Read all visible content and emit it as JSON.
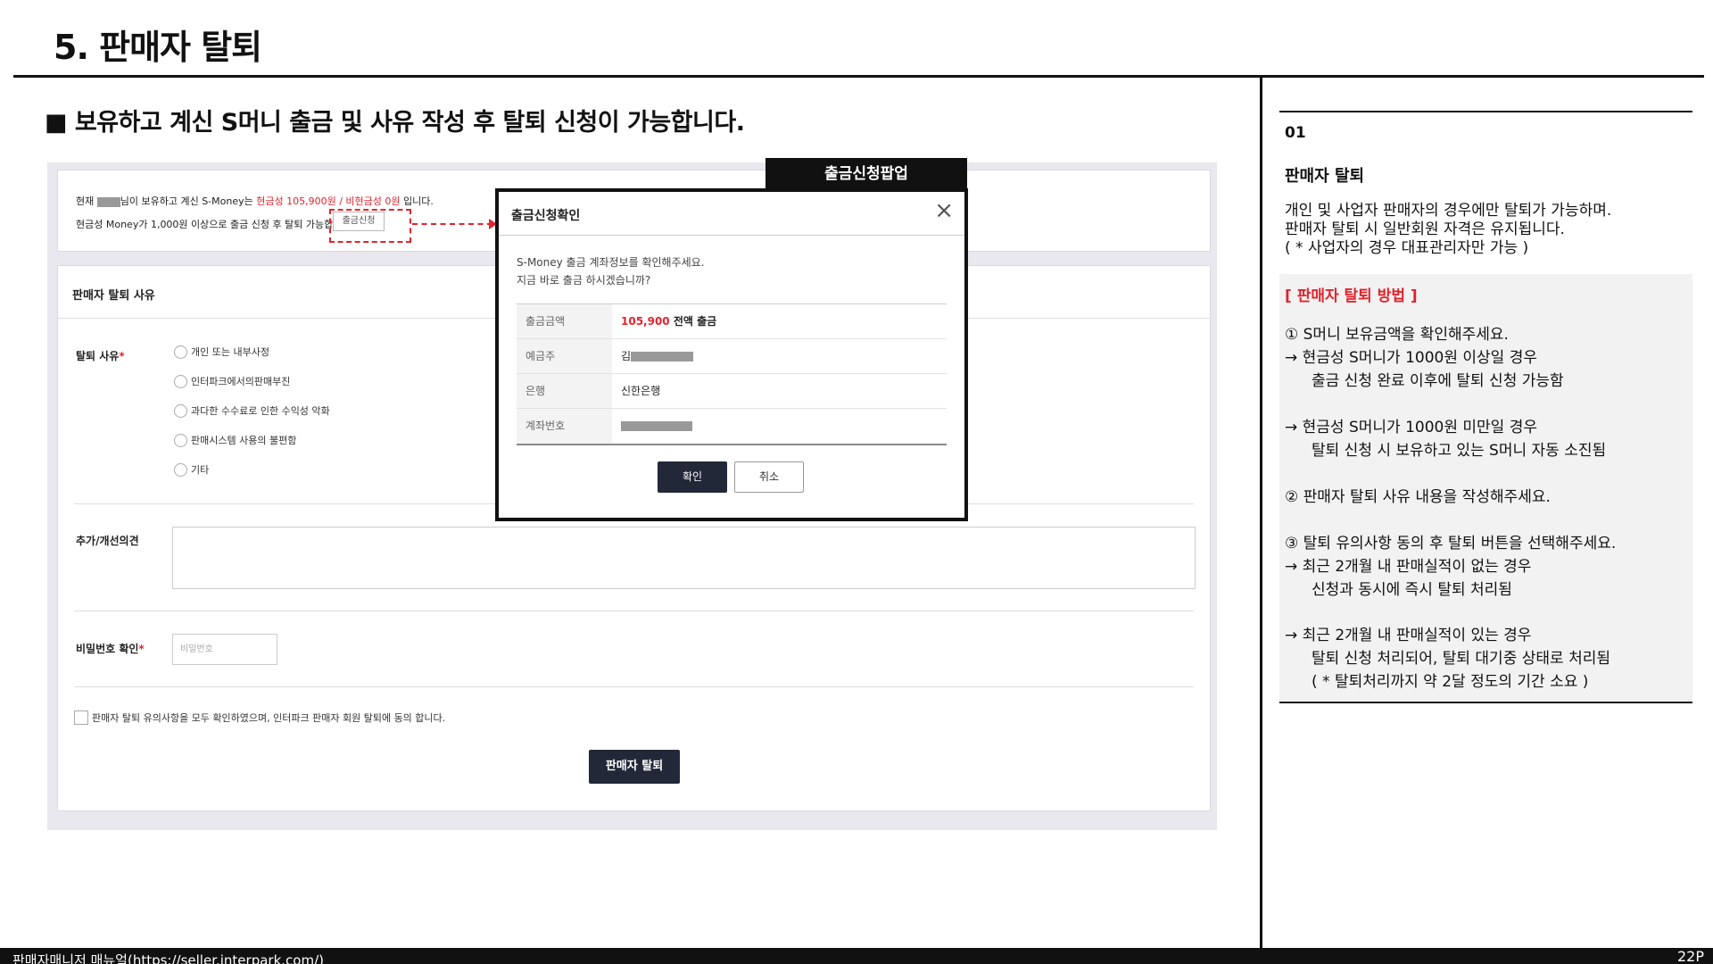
{
  "page": {
    "title": "5. 판매자 탈퇴",
    "subheading": "■ 보유하고 계신 S머니 출금 및 사유 작성 후 탈퇴 신청이 가능합니다."
  },
  "smoney_box": {
    "line1_prefix": "현재 ",
    "line1_masked_suffix": "님이 보유하고 계신 S-Money는 ",
    "line1_cash": "현금성 105,900원 / 비현금성 0원",
    "line1_end": " 입니다.",
    "line2": "현금성 Money가 1,000원 이상으로 출금 신청 후 탈퇴 가능합니다.",
    "withdraw_request_btn": "출금신청"
  },
  "form": {
    "header": "판매자 탈퇴 사유",
    "reason_label": "탈퇴 사유",
    "reasons": [
      "개인 또는 내부사정",
      "인터파크에서의판매부진",
      "과다한 수수료로 인한 수익성 악화",
      "판매시스템 사용의 불편함",
      "기타"
    ],
    "feedback_label": "추가/개선의견",
    "password_label": "비밀번호 확인",
    "password_placeholder": "비밀번호",
    "agree_text": "판매자 탈퇴 유의사항을 모두 확인하였으며, 인터파크 판매자 회원 탈퇴에 동의 합니다.",
    "submit": "판매자 탈퇴"
  },
  "popup": {
    "tag": "출금신청팝업",
    "title": "출금신청확인",
    "msg1": "S-Money 출금 계좌정보를 확인해주세요.",
    "msg2": "지금 바로 출금 하시겠습니까?",
    "rows": [
      {
        "label": "출금금액",
        "amount": "105,900",
        "suffix": " 전액 출금"
      },
      {
        "label": "예금주",
        "value": "김"
      },
      {
        "label": "은행",
        "value": "신한은행"
      },
      {
        "label": "계좌번호",
        "value": ""
      }
    ],
    "ok": "확인",
    "cancel": "취소"
  },
  "right_panel": {
    "number": "01",
    "title": "판매자 탈퇴",
    "desc": [
      "개인 및 사업자 판매자의 경우에만 탈퇴가 가능하며.",
      "판매자 탈퇴 시 일반회원 자격은 유지됩니다.",
      "( * 사업자의 경우 대표관리자만 가능 )"
    ],
    "method_title": "[ 판매자 탈퇴 방법 ]",
    "step1": "① S머니 보유금액을 확인해주세요.",
    "step1_a": " → 현금성 S머니가 1000원 이상일 경우",
    "step1_a2": "출금 신청 완료 이후에 탈퇴 신청 가능함",
    "step1_b": " → 현금성 S머니가 1000원 미만일 경우",
    "step1_b2": "탈퇴 신청 시 보유하고 있는 S머니 자동 소진됨",
    "step2": "② 판매자 탈퇴 사유 내용을 작성해주세요.",
    "step3": "③ 탈퇴 유의사항 동의 후 탈퇴 버튼을 선택해주세요.",
    "step3_a": " → 최근 2개월 내 판매실적이 없는 경우",
    "step3_a2": "신청과 동시에 즉시 탈퇴 처리됨",
    "step3_b": " → 최근 2개월 내 판매실적이 있는 경우",
    "step3_b2": "탈퇴 신청 처리되어, 탈퇴 대기중 상태로 처리됨",
    "step3_b3": "( * 탈퇴처리까지 약 2달 정도의 기간 소요  )"
  },
  "footer": {
    "left": "판매자매니저 매뉴얼(https://seller.interpark.com/)",
    "page": "22P"
  }
}
